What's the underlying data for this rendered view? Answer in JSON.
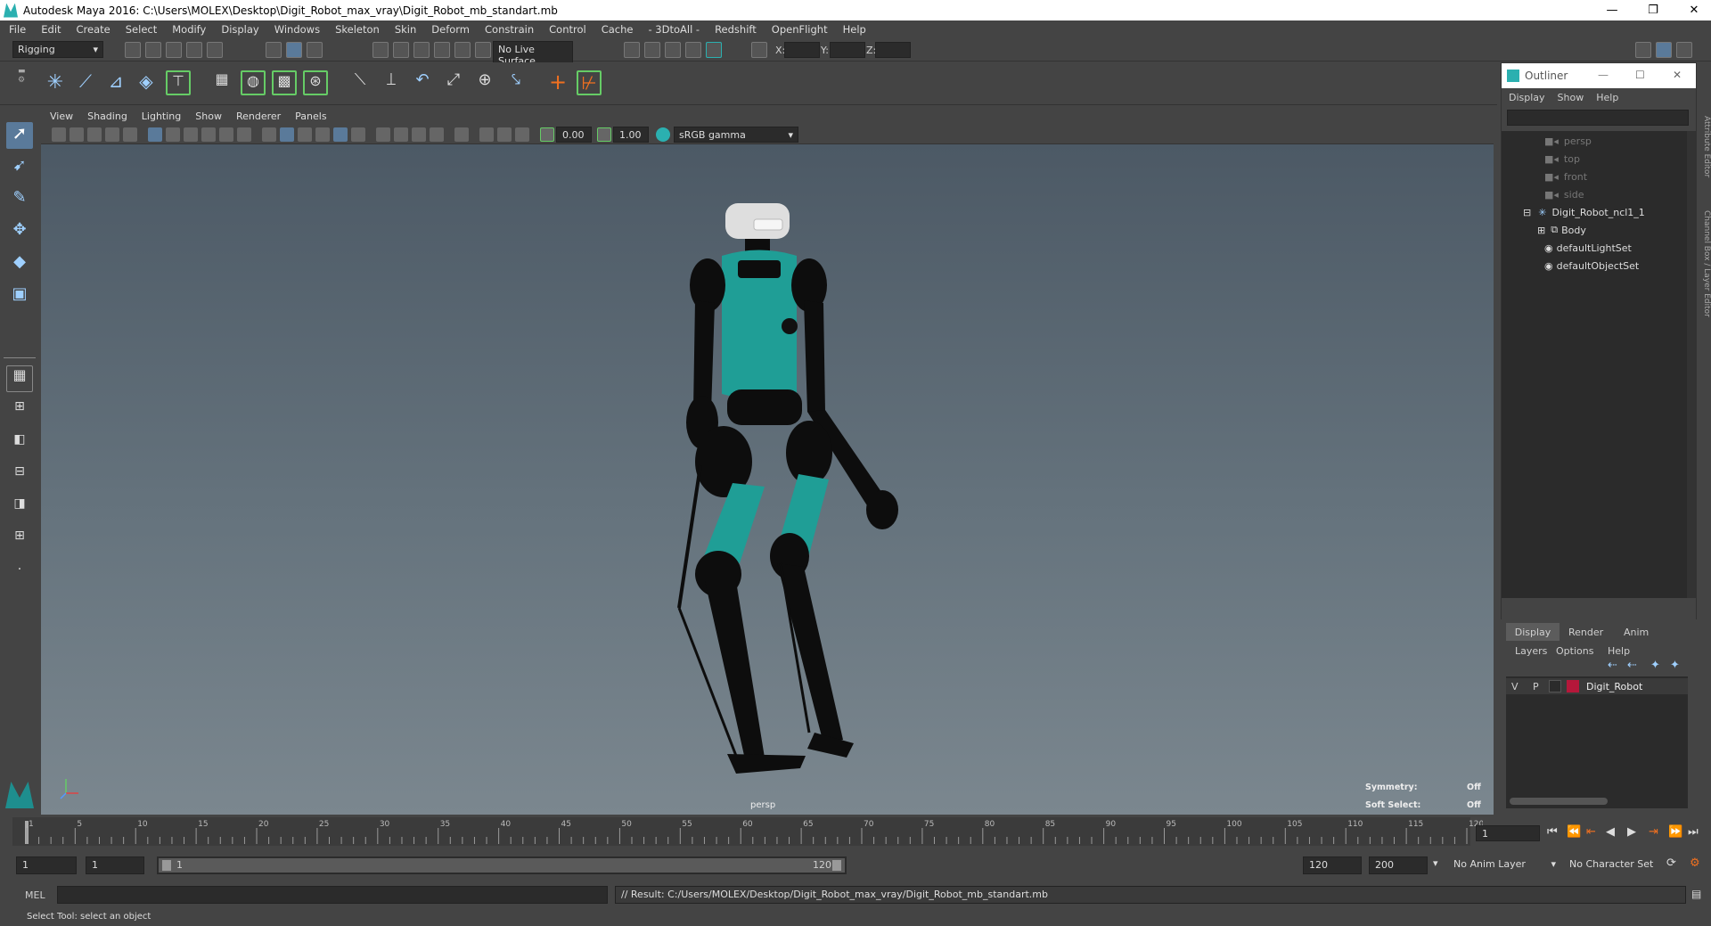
{
  "window": {
    "title": "Autodesk Maya 2016: C:\\Users\\MOLEX\\Desktop\\Digit_Robot_max_vray\\Digit_Robot_mb_standart.mb"
  },
  "menu": [
    "File",
    "Edit",
    "Create",
    "Select",
    "Modify",
    "Display",
    "Windows",
    "Skeleton",
    "Skin",
    "Deform",
    "Constrain",
    "Control",
    "Cache",
    "- 3DtoAll -",
    "Redshift",
    "OpenFlight",
    "Help"
  ],
  "status": {
    "mode": "Rigging",
    "live_surface": "No Live Surface",
    "x_label": "X:",
    "y_label": "Y:",
    "z_label": "Z:"
  },
  "viewport_menu": [
    "View",
    "Shading",
    "Lighting",
    "Show",
    "Renderer",
    "Panels"
  ],
  "viewport_tools": {
    "exposure": "0.00",
    "gamma": "1.00",
    "color_space": "sRGB gamma"
  },
  "viewport": {
    "camera": "persp",
    "symmetry_label": "Symmetry:",
    "symmetry_value": "Off",
    "soft_select_label": "Soft Select:",
    "soft_select_value": "Off"
  },
  "outliner": {
    "title": "Outliner",
    "menu": [
      "Display",
      "Show",
      "Help"
    ],
    "items": [
      "persp",
      "top",
      "front",
      "side",
      "Digit_Robot_ncl1_1",
      "Body",
      "defaultLightSet",
      "defaultObjectSet"
    ],
    "side_tabs": [
      "Attribute Editor",
      "Channel Box / Layer Editor"
    ]
  },
  "layers": {
    "tabs": [
      "Display",
      "Render",
      "Anim"
    ],
    "menu": [
      "Layers",
      "Options",
      "Help"
    ],
    "row": {
      "v": "V",
      "p": "P",
      "name": "Digit_Robot",
      "color": "#b5173a"
    }
  },
  "timeline": {
    "ticks": [
      "1",
      "5",
      "10",
      "15",
      "20",
      "25",
      "30",
      "35",
      "40",
      "45",
      "50",
      "55",
      "60",
      "65",
      "70",
      "75",
      "80",
      "85",
      "90",
      "95",
      "100",
      "105",
      "110",
      "115",
      "120"
    ],
    "current_frame": "1"
  },
  "range": {
    "start": "1",
    "playback_start": "1",
    "slider_start": "1",
    "slider_end": "120",
    "playback_end": "120",
    "end": "200",
    "anim_layer": "No Anim Layer",
    "character_set": "No Character Set"
  },
  "cmd": {
    "lang": "MEL",
    "result": "// Result: C:/Users/MOLEX/Desktop/Digit_Robot_max_vray/Digit_Robot_mb_standart.mb"
  },
  "help": {
    "text": "Select Tool: select an object"
  },
  "colors": {
    "accent": "#2bb0b0",
    "robot_teal": "#1f9e96",
    "robot_black": "#0d0d0d"
  }
}
